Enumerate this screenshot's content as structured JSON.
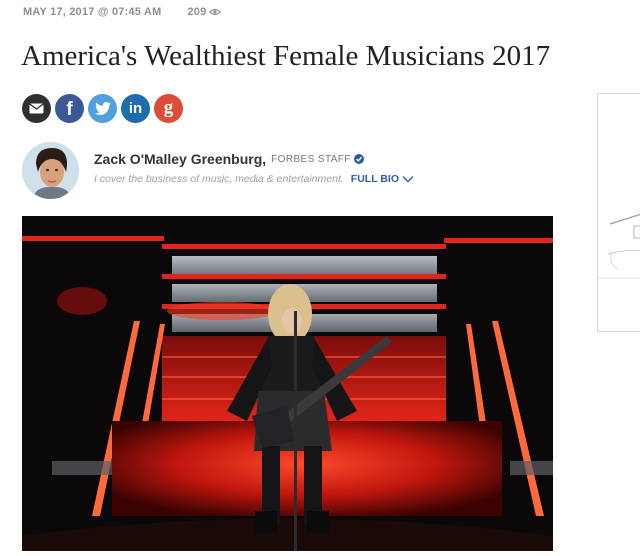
{
  "article": {
    "date": "MAY 17, 2017 @ 07:45 AM",
    "views": "209",
    "title": "America's Wealthiest Female Musicians 2017"
  },
  "share": [
    {
      "name": "email",
      "glyph": "✉",
      "color": "#2e2e2e"
    },
    {
      "name": "facebook",
      "glyph": "f",
      "color": "#3b5998"
    },
    {
      "name": "twitter",
      "glyph": "🐦",
      "color": "#4fa0dc"
    },
    {
      "name": "linkedin",
      "glyph": "in",
      "color": "#1e6cae"
    },
    {
      "name": "google-plus",
      "glyph": "g",
      "color": "#dd4b39"
    }
  ],
  "author": {
    "name": "Zack O'Malley Greenburg,",
    "role": "FORBES STAFF",
    "bio": "I cover the business of music, media & entertainment.",
    "full_bio": "FULL BIO"
  },
  "colors": {
    "link_blue": "#2b5fa8",
    "stage_red": "#e2241b"
  }
}
